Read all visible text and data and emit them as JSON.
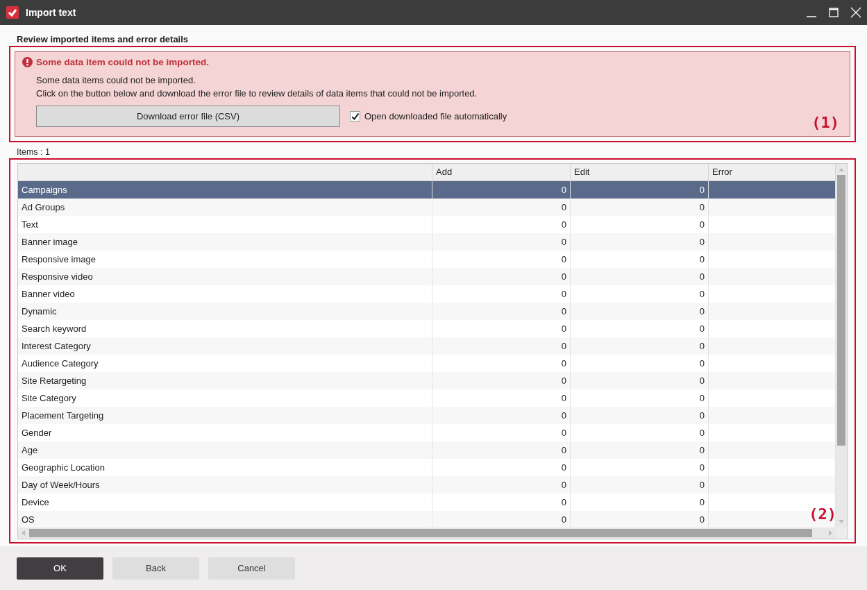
{
  "window": {
    "title": "Import text"
  },
  "heading": "Review imported items and error details",
  "error_panel": {
    "title": "Some data item could not be imported.",
    "lines": [
      "Some data items could not be imported.",
      "Click on the button below and download the error file to review details of data items that could not be imported."
    ],
    "download_button": "Download error file (CSV)",
    "auto_open": {
      "label": "Open downloaded file automatically",
      "checked": true
    }
  },
  "callouts": [
    "(1)",
    "(2)"
  ],
  "items_count": "Items : 1",
  "table": {
    "columns": [
      "Add",
      "Edit",
      "Error"
    ],
    "rows": [
      {
        "name": "Campaigns",
        "add": "0",
        "edit": "0",
        "selected": true
      },
      {
        "name": "Ad Groups",
        "add": "0",
        "edit": "0",
        "selected": false
      },
      {
        "name": "Text",
        "add": "0",
        "edit": "0",
        "selected": false
      },
      {
        "name": "Banner image",
        "add": "0",
        "edit": "0",
        "selected": false
      },
      {
        "name": "Responsive image",
        "add": "0",
        "edit": "0",
        "selected": false
      },
      {
        "name": "Responsive video",
        "add": "0",
        "edit": "0",
        "selected": false
      },
      {
        "name": "Banner video",
        "add": "0",
        "edit": "0",
        "selected": false
      },
      {
        "name": "Dynamic",
        "add": "0",
        "edit": "0",
        "selected": false
      },
      {
        "name": "Search keyword",
        "add": "0",
        "edit": "0",
        "selected": false
      },
      {
        "name": "Interest Category",
        "add": "0",
        "edit": "0",
        "selected": false
      },
      {
        "name": "Audience Category",
        "add": "0",
        "edit": "0",
        "selected": false
      },
      {
        "name": "Site Retargeting",
        "add": "0",
        "edit": "0",
        "selected": false
      },
      {
        "name": "Site Category",
        "add": "0",
        "edit": "0",
        "selected": false
      },
      {
        "name": "Placement Targeting",
        "add": "0",
        "edit": "0",
        "selected": false
      },
      {
        "name": "Gender",
        "add": "0",
        "edit": "0",
        "selected": false
      },
      {
        "name": "Age",
        "add": "0",
        "edit": "0",
        "selected": false
      },
      {
        "name": "Geographic Location",
        "add": "0",
        "edit": "0",
        "selected": false
      },
      {
        "name": "Day of Week/Hours",
        "add": "0",
        "edit": "0",
        "selected": false
      },
      {
        "name": "Device",
        "add": "0",
        "edit": "0",
        "selected": false
      },
      {
        "name": "OS",
        "add": "0",
        "edit": "0",
        "selected": false
      }
    ]
  },
  "buttons": [
    {
      "label": "OK",
      "kind": "primary"
    },
    {
      "label": "Back",
      "kind": "secondary"
    },
    {
      "label": "Cancel",
      "kind": "secondary"
    }
  ]
}
